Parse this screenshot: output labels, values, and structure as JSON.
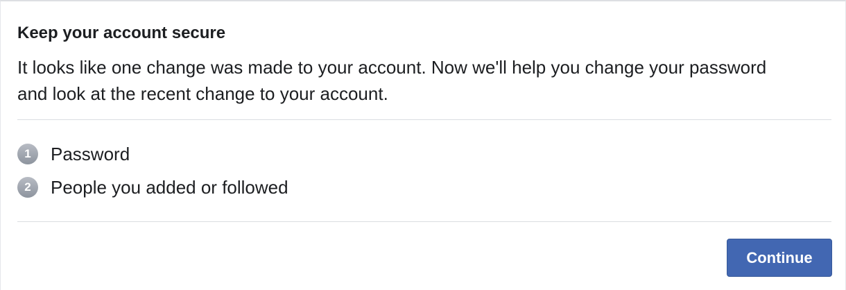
{
  "dialog": {
    "title": "Keep your account secure",
    "description": "It looks like one change was made to your account. Now we'll help you change your password and look at the recent change to your account."
  },
  "steps": [
    {
      "number": "1",
      "label": "Password"
    },
    {
      "number": "2",
      "label": "People you added or followed"
    }
  ],
  "actions": {
    "continue_label": "Continue"
  },
  "colors": {
    "primary_button": "#4267b2",
    "step_badge": "#8d949e",
    "divider": "#dadde1",
    "text": "#1c1e21"
  }
}
